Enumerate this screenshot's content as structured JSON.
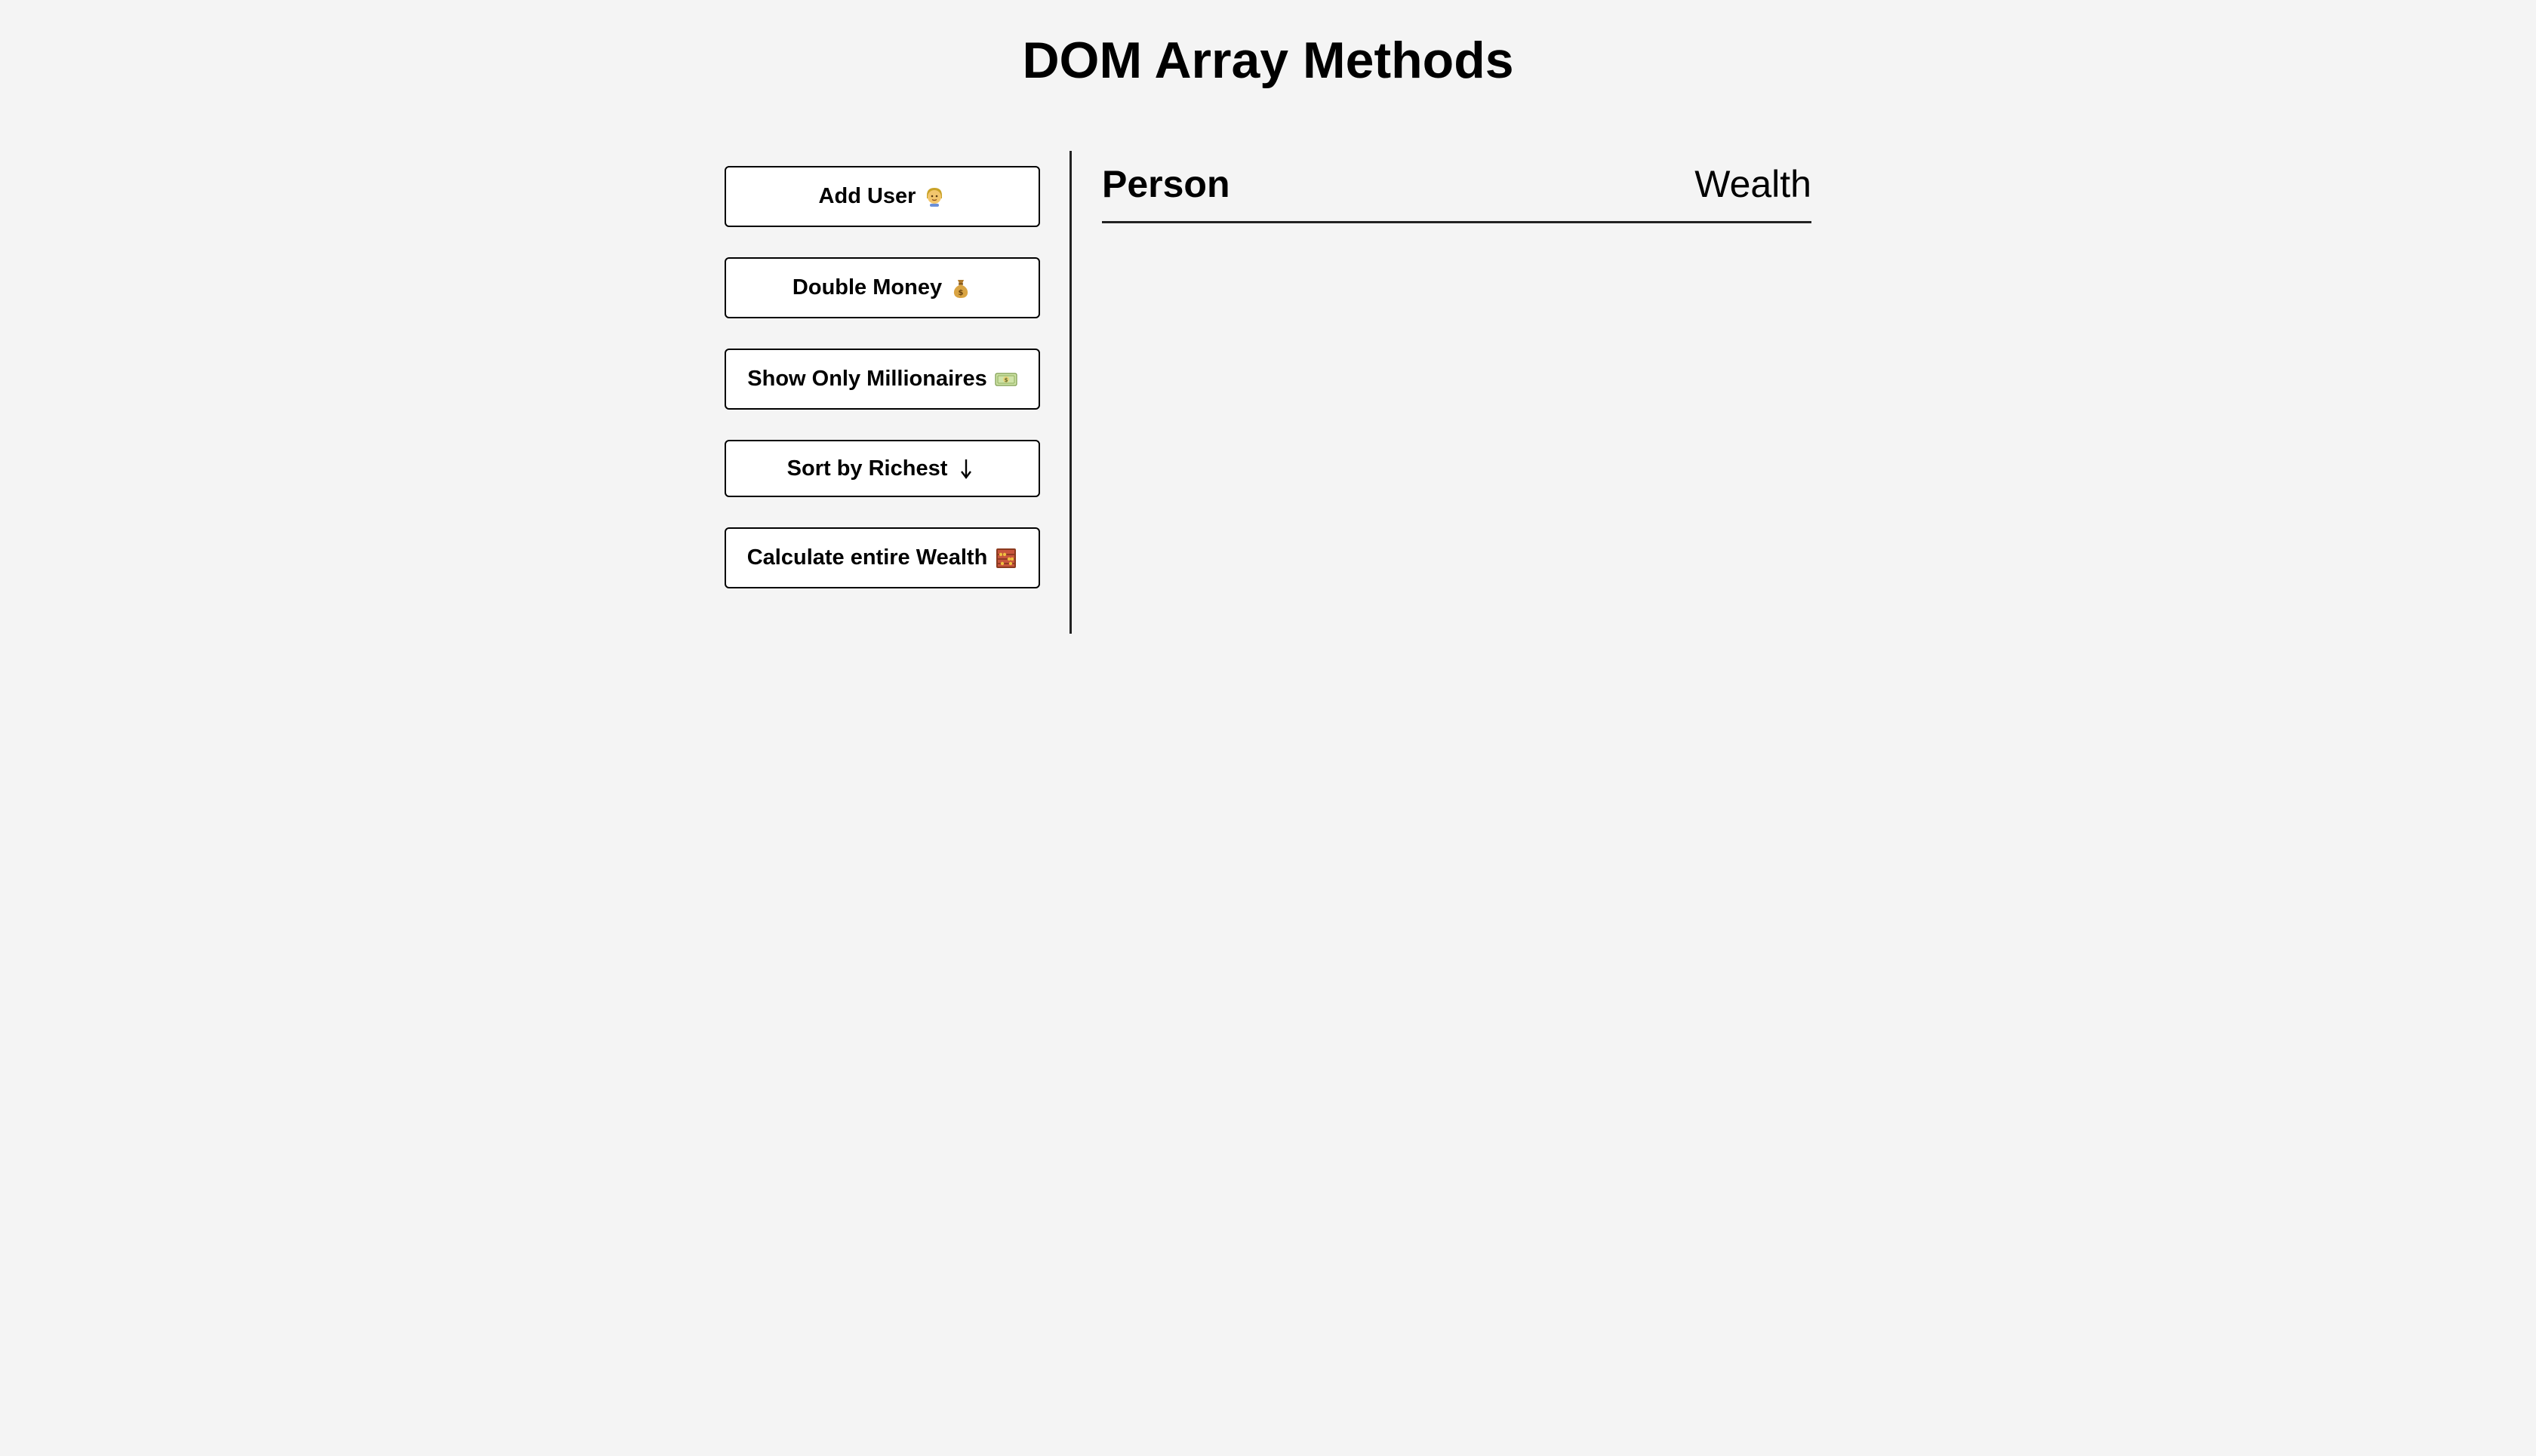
{
  "page": {
    "title": "DOM Array Methods"
  },
  "controls": {
    "add_user": "Add User",
    "double_money": "Double Money",
    "show_millionaires": "Show Only Millionaires",
    "sort_richest": "Sort by Richest",
    "calculate_wealth": "Calculate entire Wealth"
  },
  "icons": {
    "add_user": "person-emoji-icon",
    "double_money": "money-bag-icon",
    "show_millionaires": "dollar-banknote-icon",
    "sort_richest": "down-arrow-icon",
    "calculate_wealth": "abacus-icon"
  },
  "table": {
    "person_header": "Person",
    "wealth_header": "Wealth"
  },
  "colors": {
    "background": "#f4f4f4",
    "button_bg": "#ffffff",
    "border": "#000000"
  }
}
